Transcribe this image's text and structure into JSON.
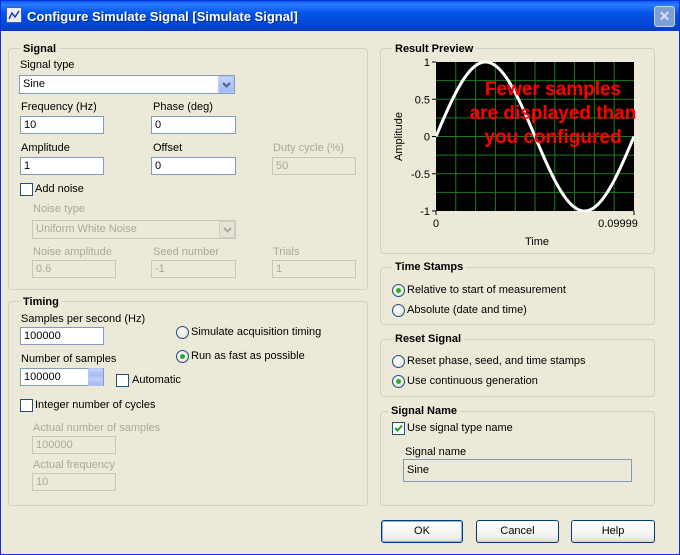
{
  "window": {
    "title": "Configure Simulate Signal [Simulate Signal]",
    "close_glyph": "✕"
  },
  "signal": {
    "title": "Signal",
    "signal_type_label": "Signal type",
    "signal_type_value": "Sine",
    "frequency_label": "Frequency (Hz)",
    "frequency_value": "10",
    "phase_label": "Phase (deg)",
    "phase_value": "0",
    "amplitude_label": "Amplitude",
    "amplitude_value": "1",
    "offset_label": "Offset",
    "offset_value": "0",
    "duty_cycle_label": "Duty cycle (%)",
    "duty_cycle_value": "50",
    "add_noise_label": "Add noise",
    "add_noise_checked": false,
    "noise_type_label": "Noise type",
    "noise_type_value": "Uniform White Noise",
    "noise_amplitude_label": "Noise amplitude",
    "noise_amplitude_value": "0.6",
    "seed_number_label": "Seed number",
    "seed_number_value": "-1",
    "trials_label": "Trials",
    "trials_value": "1"
  },
  "timing": {
    "title": "Timing",
    "samples_per_second_label": "Samples per second (Hz)",
    "samples_per_second_value": "100000",
    "simulate_acq_label": "Simulate acquisition timing",
    "run_fast_label": "Run as fast as possible",
    "selected_mode": "Run as fast as possible",
    "number_of_samples_label": "Number of samples",
    "number_of_samples_value": "100000",
    "automatic_label": "Automatic",
    "automatic_checked": false,
    "integer_cycles_label": "Integer number of cycles",
    "integer_cycles_checked": false,
    "actual_samples_label": "Actual number of samples",
    "actual_samples_value": "100000",
    "actual_frequency_label": "Actual frequency",
    "actual_frequency_value": "10"
  },
  "result_preview": {
    "title": "Result Preview",
    "warning": [
      "Fewer samples",
      "are displayed than",
      "you configured"
    ],
    "warning_color": "#ff0000",
    "plot_bg": "#000000",
    "grid_color": "#1f7a1f",
    "trace_color": "#ffffff",
    "chart_data": {
      "type": "line",
      "title": "",
      "xlabel": "Time",
      "ylabel": "Amplitude",
      "xlim": [
        0,
        0.09999
      ],
      "ylim": [
        -1,
        1
      ],
      "x_ticks": [
        "0",
        "0.09999"
      ],
      "y_ticks": [
        "1",
        "0.5",
        "0",
        "-0.5",
        "-1"
      ],
      "series": [
        {
          "function": "sin(2*pi*10*t)",
          "frequency_hz": 10,
          "amplitude": 1,
          "phase_deg": 0
        }
      ]
    }
  },
  "time_stamps": {
    "title": "Time Stamps",
    "relative_label": "Relative to start of measurement",
    "absolute_label": "Absolute (date and time)",
    "selected": "Relative to start of measurement"
  },
  "reset_signal": {
    "title": "Reset Signal",
    "reset_label": "Reset phase, seed, and time stamps",
    "continuous_label": "Use continuous generation",
    "selected": "Use continuous generation"
  },
  "signal_name": {
    "title": "Signal Name",
    "use_type_name_label": "Use signal type name",
    "use_type_name_checked": true,
    "name_label": "Signal name",
    "name_value": "Sine"
  },
  "buttons": {
    "ok": "OK",
    "cancel": "Cancel",
    "help": "Help"
  }
}
